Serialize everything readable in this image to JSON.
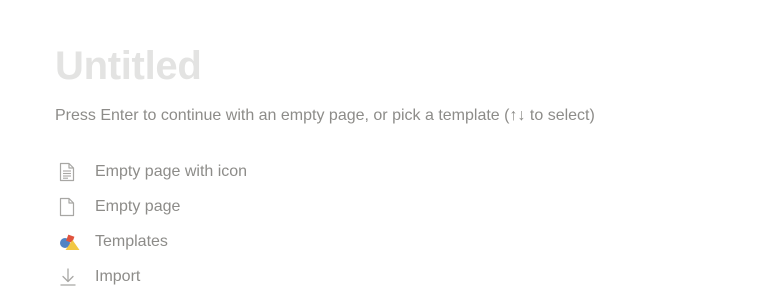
{
  "page": {
    "title_placeholder": "Untitled",
    "hint": "Press Enter to continue with an empty page, or pick a template (↑↓ to select)"
  },
  "options": [
    {
      "label": "Empty page with icon",
      "icon": "document-lines-icon"
    },
    {
      "label": "Empty page",
      "icon": "blank-document-icon"
    },
    {
      "label": "Templates",
      "icon": "templates-shapes-icon"
    },
    {
      "label": "Import",
      "icon": "import-arrow-icon"
    }
  ],
  "colors": {
    "title": "#e3e3e2",
    "text": "#8d8c89",
    "icon": "#a8a7a4",
    "shape_blue": "#4f83c4",
    "shape_red": "#e0533d",
    "shape_yellow": "#f2c744"
  }
}
